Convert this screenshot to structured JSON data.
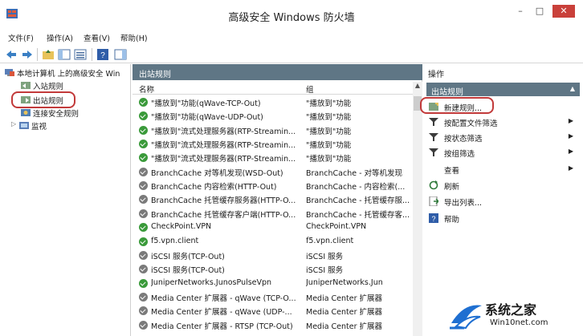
{
  "window": {
    "title": "高级安全 Windows 防火墙",
    "min": "–",
    "max": "□",
    "close": "✕"
  },
  "menu": [
    "文件(F)",
    "操作(A)",
    "查看(V)",
    "帮助(H)"
  ],
  "tree": {
    "root": "本地计算机 上的高级安全 Win",
    "items": [
      "入站规则",
      "出站规则",
      "连接安全规则",
      "监视"
    ]
  },
  "center": {
    "panel_title": "出站规则",
    "col_name": "名称",
    "col_group": "组",
    "rows": [
      {
        "name": "\"播放到\"功能(qWave-TCP-Out)",
        "group": "\"播放到\"功能",
        "enabled": true
      },
      {
        "name": "\"播放到\"功能(qWave-UDP-Out)",
        "group": "\"播放到\"功能",
        "enabled": true
      },
      {
        "name": "\"播放到\"流式处理服务器(RTP-Streamin...",
        "group": "\"播放到\"功能",
        "enabled": true
      },
      {
        "name": "\"播放到\"流式处理服务器(RTP-Streamin...",
        "group": "\"播放到\"功能",
        "enabled": true
      },
      {
        "name": "\"播放到\"流式处理服务器(RTP-Streamin...",
        "group": "\"播放到\"功能",
        "enabled": true
      },
      {
        "name": "BranchCache 对等机发现(WSD-Out)",
        "group": "BranchCache - 对等机发现",
        "enabled": false
      },
      {
        "name": "BranchCache 内容检索(HTTP-Out)",
        "group": "BranchCache - 内容检索(...",
        "enabled": false
      },
      {
        "name": "BranchCache 托管缓存服务器(HTTP-O...",
        "group": "BranchCache - 托管缓存服...",
        "enabled": false
      },
      {
        "name": "BranchCache 托管缓存客户端(HTTP-O...",
        "group": "BranchCache - 托管缓存客...",
        "enabled": false
      },
      {
        "name": "CheckPoint.VPN",
        "group": "CheckPoint.VPN",
        "enabled": true
      },
      {
        "name": "f5.vpn.client",
        "group": "f5.vpn.client",
        "enabled": true
      },
      {
        "name": "iSCSI 服务(TCP-Out)",
        "group": "iSCSI 服务",
        "enabled": false
      },
      {
        "name": "iSCSI 服务(TCP-Out)",
        "group": "iSCSI 服务",
        "enabled": false
      },
      {
        "name": "JuniperNetworks.JunosPulseVpn",
        "group": "JuniperNetworks.Jun",
        "enabled": true
      },
      {
        "name": "Media Center 扩展器 - qWave (TCP-O...",
        "group": "Media Center 扩展器",
        "enabled": false
      },
      {
        "name": "Media Center 扩展器 - qWave (UDP-...",
        "group": "Media Center 扩展器",
        "enabled": false
      },
      {
        "name": "Media Center 扩展器 - RTSP (TCP-Out)",
        "group": "Media Center 扩展器",
        "enabled": false
      }
    ]
  },
  "actions": {
    "header": "操作",
    "section": "出站规则",
    "items": [
      {
        "label": "新建规则...",
        "submenu": false
      },
      {
        "label": "按配置文件筛选",
        "submenu": true
      },
      {
        "label": "按状态筛选",
        "submenu": true
      },
      {
        "label": "按组筛选",
        "submenu": true
      },
      {
        "label": "查看",
        "submenu": true
      },
      {
        "label": "刷新",
        "submenu": false
      },
      {
        "label": "导出列表...",
        "submenu": false
      },
      {
        "label": "帮助",
        "submenu": false
      }
    ]
  },
  "watermark": {
    "main": "系统之家",
    "url": "Win10net.com"
  },
  "colors": {
    "panel_header": "#5f7685",
    "enabled": "#3a9a3a",
    "disabled": "#7a7a7a",
    "highlight_ring": "#c23a3a"
  }
}
